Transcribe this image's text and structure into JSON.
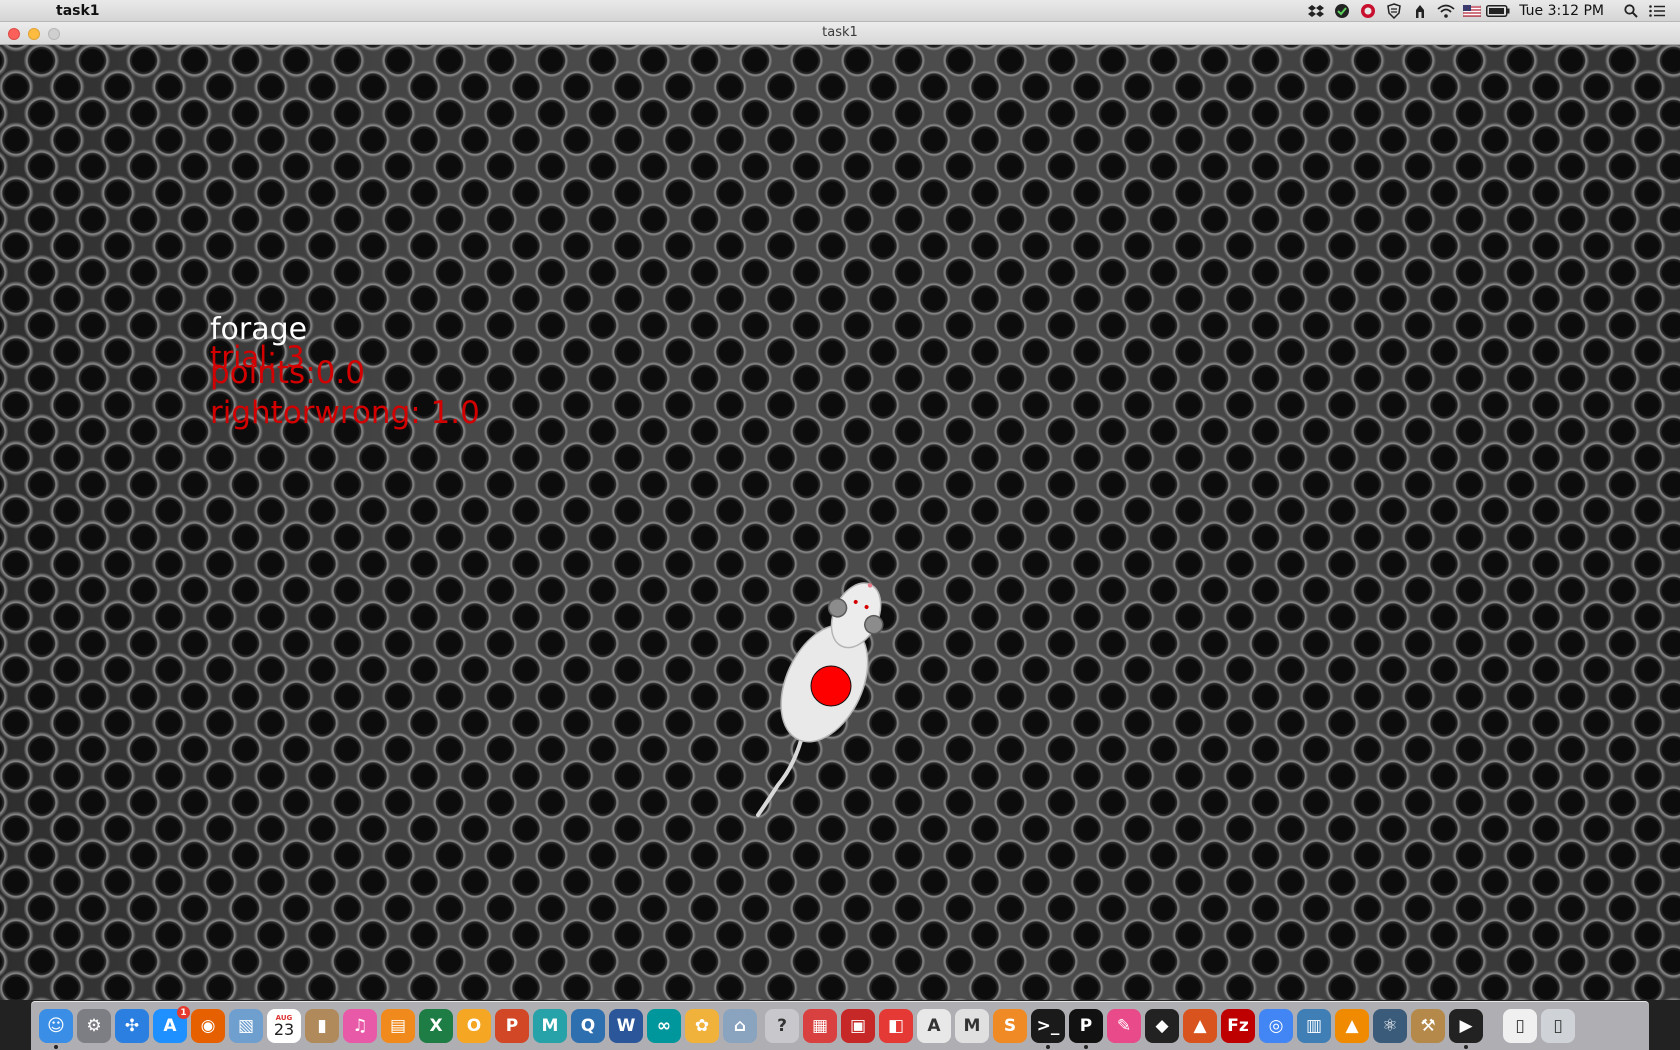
{
  "menubar": {
    "app_name": "task1",
    "clock": "Tue 3:12 PM",
    "status_icons": [
      "dropbox-icon",
      "evernote-icon",
      "opera-icon",
      "shield-icon",
      "alfred-icon",
      "wifi-icon",
      "flag-icon",
      "battery-icon",
      "spotlight-icon",
      "notification-center-icon"
    ]
  },
  "window": {
    "title": "task1"
  },
  "game": {
    "mode": "forage",
    "trial": "trial: 3",
    "points": "points:0.0",
    "rightorwrong": "rightorwrong: 1.0",
    "hud_color": "#d40000",
    "target_color": "#ff0000"
  },
  "dock": {
    "calendar_day": "23",
    "calendar_month": "AUG",
    "app_store_badge": "1",
    "apps": [
      {
        "name": "finder-icon",
        "glyph": "☺",
        "bg": "#3a8ee6",
        "running": true
      },
      {
        "name": "system-preferences-icon",
        "glyph": "⚙",
        "bg": "#7d7d84",
        "running": false
      },
      {
        "name": "safari-icon",
        "glyph": "✣",
        "bg": "#2a7fe0",
        "running": false
      },
      {
        "name": "app-store-icon",
        "glyph": "A",
        "bg": "#1e90ff",
        "running": false,
        "badge": true
      },
      {
        "name": "firefox-icon",
        "glyph": "◉",
        "bg": "#e66000",
        "running": false
      },
      {
        "name": "preview-icon",
        "glyph": "▧",
        "bg": "#6f9fcf",
        "running": false
      },
      {
        "name": "calendar-icon",
        "glyph": "",
        "bg": "#ffffff",
        "running": false,
        "calendar": true
      },
      {
        "name": "contacts-icon",
        "glyph": "▮",
        "bg": "#b08a5a",
        "running": false
      },
      {
        "name": "itunes-icon",
        "glyph": "♫",
        "bg": "#e85aa8",
        "running": false
      },
      {
        "name": "ibooks-icon",
        "glyph": "▤",
        "bg": "#f08a1c",
        "running": false
      },
      {
        "name": "excel-icon",
        "glyph": "X",
        "bg": "#1e7c45",
        "running": false
      },
      {
        "name": "pages-icon",
        "glyph": "O",
        "bg": "#f5a623",
        "running": false
      },
      {
        "name": "powerpoint-icon",
        "glyph": "P",
        "bg": "#d24726",
        "running": false
      },
      {
        "name": "mendeley-icon",
        "glyph": "M",
        "bg": "#27a2a8",
        "running": false
      },
      {
        "name": "quicktime-icon",
        "glyph": "Q",
        "bg": "#2e6fb0",
        "running": false
      },
      {
        "name": "word-icon",
        "glyph": "W",
        "bg": "#2b579a",
        "running": false
      },
      {
        "name": "arduino-icon",
        "glyph": "∞",
        "bg": "#00979c",
        "running": false
      },
      {
        "name": "photos-icon",
        "glyph": "✿",
        "bg": "#f0b23a",
        "running": false
      },
      {
        "name": "disk-utility-icon",
        "glyph": "⌂",
        "bg": "#8aa4c0",
        "running": false
      },
      {
        "name": "help-icon",
        "glyph": "?",
        "bg": "#c8c8cc",
        "running": false
      },
      {
        "name": "pdf-app-icon",
        "glyph": "▦",
        "bg": "#d94040",
        "running": false
      },
      {
        "name": "acrobat-icon",
        "glyph": "▣",
        "bg": "#c62828",
        "running": false
      },
      {
        "name": "pdf-reader-icon",
        "glyph": "◧",
        "bg": "#e53935",
        "running": false
      },
      {
        "name": "font-book-icon",
        "glyph": "A",
        "bg": "#e8e8e8",
        "running": false
      },
      {
        "name": "mail-m-icon",
        "glyph": "M",
        "bg": "#e0e0e0",
        "running": false
      },
      {
        "name": "sublime-icon",
        "glyph": "S",
        "bg": "#f08a24",
        "running": false
      },
      {
        "name": "terminal-icon",
        "glyph": ">_",
        "bg": "#1a1a1a",
        "running": true
      },
      {
        "name": "p-app-icon",
        "glyph": "P",
        "bg": "#111111",
        "running": true
      },
      {
        "name": "sketch-icon",
        "glyph": "✎",
        "bg": "#e84a8a",
        "running": false
      },
      {
        "name": "unity-icon",
        "glyph": "◆",
        "bg": "#222222",
        "running": false
      },
      {
        "name": "matlab-icon",
        "glyph": "▲",
        "bg": "#d9531e",
        "running": false
      },
      {
        "name": "filezilla-icon",
        "glyph": "Fz",
        "bg": "#bf0000",
        "running": false
      },
      {
        "name": "chrome-icon",
        "glyph": "◎",
        "bg": "#4285f4",
        "running": false
      },
      {
        "name": "keyboard-app-icon",
        "glyph": "▥",
        "bg": "#3f7fb5",
        "running": false
      },
      {
        "name": "vlc-icon",
        "glyph": "▲",
        "bg": "#f08a00",
        "running": false
      },
      {
        "name": "atom-icon",
        "glyph": "⚛",
        "bg": "#3b5b7a",
        "running": false
      },
      {
        "name": "instruments-icon",
        "glyph": "⚒",
        "bg": "#b5894a",
        "running": false
      },
      {
        "name": "quicktime-player-icon",
        "glyph": "▶",
        "bg": "#222222",
        "running": true
      },
      {
        "name": "documents-folder-icon",
        "glyph": "▯",
        "bg": "#f0f0f0",
        "running": false
      },
      {
        "name": "trash-icon",
        "glyph": "▯",
        "bg": "#cfd2d6",
        "running": false
      }
    ]
  }
}
